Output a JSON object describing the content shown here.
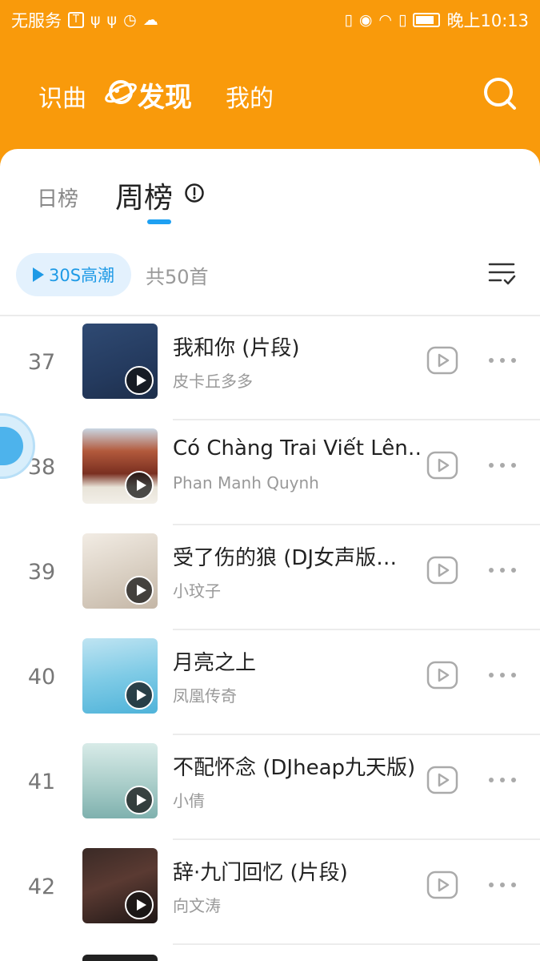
{
  "status_bar": {
    "carrier": "无服务",
    "time": "晚上10:13"
  },
  "header": {
    "nav": {
      "identify": "识曲",
      "discover": "发现",
      "mine": "我的"
    }
  },
  "chart_tabs": {
    "daily": "日榜",
    "weekly": "周榜",
    "active": "weekly"
  },
  "toolbar": {
    "preview_label": "30S高潮",
    "count_label": "共50首"
  },
  "songs": [
    {
      "rank": "37",
      "title": "我和你 (片段)",
      "artist": "皮卡丘多多"
    },
    {
      "rank": "38",
      "title": "Có Chàng Trai Viết Lên…",
      "artist": "Phan Manh Quynh"
    },
    {
      "rank": "39",
      "title": "受了伤的狼 (DJ女声版…",
      "artist": "小玟子"
    },
    {
      "rank": "40",
      "title": "月亮之上",
      "artist": "凤凰传奇"
    },
    {
      "rank": "41",
      "title": "不配怀念 (DJheap九天版)",
      "artist": "小倩"
    },
    {
      "rank": "42",
      "title": "辞·九门回忆 (片段)",
      "artist": "向文涛"
    }
  ],
  "colors": {
    "header_bg": "#f99a0b",
    "accent": "#1e9ae6",
    "tab_indicator": "#1ea0f2"
  },
  "icons": {
    "search": "search-icon",
    "info": "info-icon",
    "filter": "filter-list-icon",
    "play": "play-outline-icon",
    "more": "more-horizontal-icon"
  }
}
